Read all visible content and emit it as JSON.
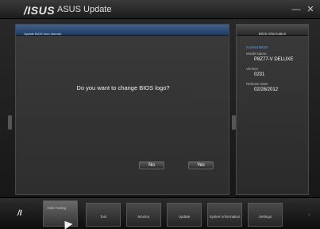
{
  "window": {
    "logo": "/ISUS",
    "title": "ASUS Update",
    "minimize_glyph": "—",
    "close_glyph": "✕"
  },
  "main": {
    "header": "Update BIOS from Internet",
    "message": "Do you want to change  BIOS logo?",
    "no_label": "No",
    "yes_label": "Yes"
  },
  "info": {
    "header": "BIOS Information",
    "section": "Current BIOS",
    "model_label": "Model Name",
    "model_value": "P8Z77-V DELUXE",
    "version_label": "Version",
    "version_value": "0231",
    "date_label": "Release Date",
    "date_value": "02/28/2012"
  },
  "tabbar": {
    "brand": "/I",
    "tabs": [
      {
        "label": "Auto Tuning"
      },
      {
        "label": "Tool"
      },
      {
        "label": "Monitor"
      },
      {
        "label": "Update"
      },
      {
        "label": "System Information"
      },
      {
        "label": "Settings"
      }
    ]
  }
}
